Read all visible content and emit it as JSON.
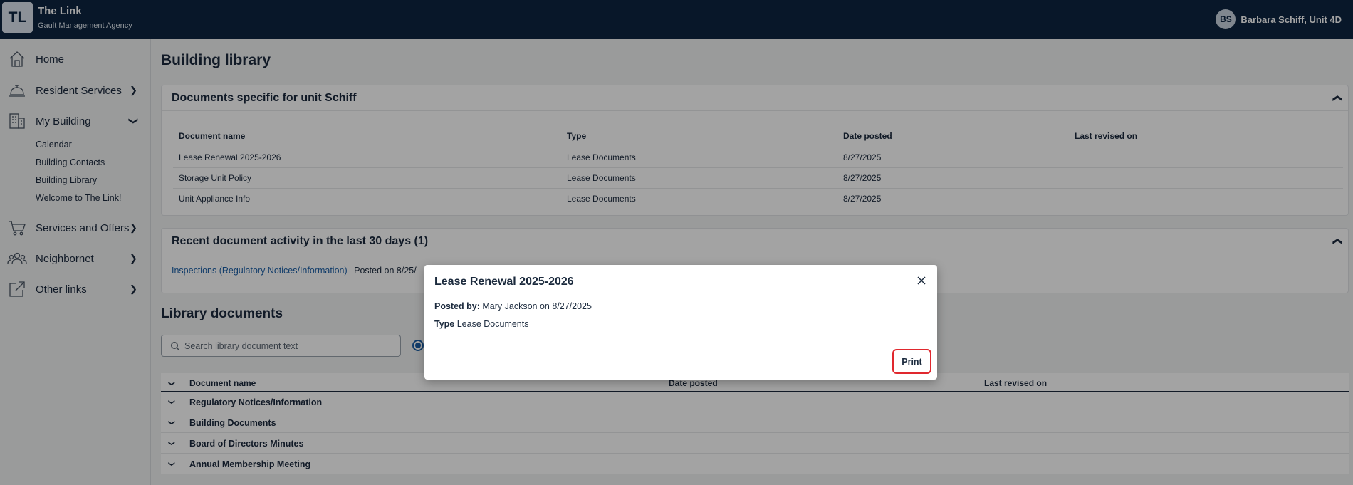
{
  "app": {
    "logo_text": "TL",
    "title": "The Link",
    "subtitle": "Gault Management Agency"
  },
  "user": {
    "initials": "BS",
    "name": "Barbara Schiff, Unit 4D"
  },
  "sidebar": {
    "items": [
      {
        "label": "Home",
        "icon": "home-icon"
      },
      {
        "label": "Resident Services",
        "icon": "bell-icon"
      },
      {
        "label": "My Building",
        "icon": "building-icon"
      },
      {
        "label": "Services and Offers",
        "icon": "cart-icon"
      },
      {
        "label": "Neighbornet",
        "icon": "people-icon"
      },
      {
        "label": "Other links",
        "icon": "external-link-icon"
      }
    ],
    "sub_items": [
      "Calendar",
      "Building Contacts",
      "Building Library",
      "Welcome to The Link!"
    ]
  },
  "page": {
    "title": "Building library"
  },
  "unit_docs": {
    "title": "Documents specific for unit Schiff",
    "columns": [
      "Document name",
      "Type",
      "Date posted",
      "Last revised on"
    ],
    "rows": [
      [
        "Lease Renewal 2025-2026",
        "Lease Documents",
        "8/27/2025",
        ""
      ],
      [
        "Storage Unit Policy",
        "Lease Documents",
        "8/27/2025",
        ""
      ],
      [
        "Unit Appliance Info",
        "Lease Documents",
        "8/27/2025",
        ""
      ]
    ]
  },
  "activity": {
    "title": "Recent document activity in the last 30 days (1)",
    "link": "Inspections (Regulatory Notices/Information)",
    "posted_text": "Posted on 8/25/"
  },
  "library": {
    "title": "Library documents",
    "search_placeholder": "Search library document text",
    "columns": [
      "Document name",
      "Date posted",
      "Last revised on"
    ],
    "rows": [
      "Regulatory Notices/Information",
      "Building Documents",
      "Board of Directors Minutes",
      "Annual Membership Meeting"
    ]
  },
  "modal": {
    "title": "Lease Renewal 2025-2026",
    "posted_by_label": "Posted by:",
    "posted_by_value": "Mary Jackson on 8/27/2025",
    "type_label": "Type",
    "type_value": "Lease Documents",
    "print_label": "Print"
  },
  "colors": {
    "topbar": "#0d2540",
    "link": "#1b5fa6",
    "highlight": "#e0282e"
  }
}
